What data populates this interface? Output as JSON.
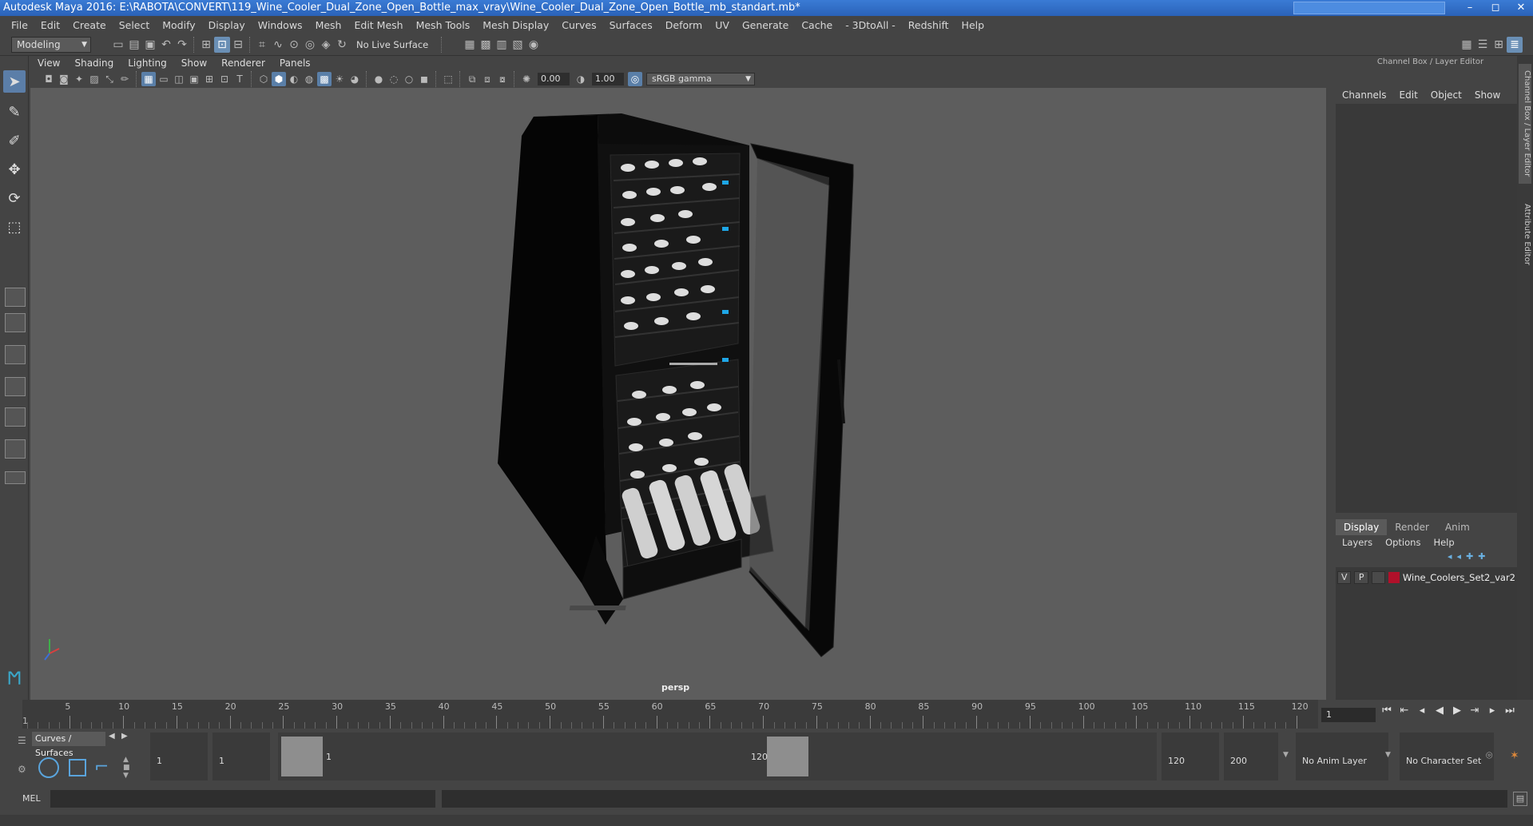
{
  "window": {
    "title": "Autodesk Maya 2016: E:\\RABOTA\\CONVERT\\119_Wine_Cooler_Dual_Zone_Open_Bottle_max_vray\\Wine_Cooler_Dual_Zone_Open_Bottle_mb_standart.mb*",
    "minimize": "–",
    "maximize": "◻",
    "close": "✕",
    "search_placeholder": ""
  },
  "menubar": [
    "File",
    "Edit",
    "Create",
    "Select",
    "Modify",
    "Display",
    "Windows",
    "Mesh",
    "Edit Mesh",
    "Mesh Tools",
    "Mesh Display",
    "Curves",
    "Surfaces",
    "Deform",
    "UV",
    "Generate",
    "Cache",
    "- 3DtoAll -",
    "Redshift",
    "Help"
  ],
  "shelf": {
    "mode": "Modeling",
    "live_surface": "No Live Surface"
  },
  "viewport": {
    "menu": [
      "View",
      "Shading",
      "Lighting",
      "Show",
      "Renderer",
      "Panels"
    ],
    "exposure": "0.00",
    "gamma": "1.00",
    "colorspace": "sRGB gamma",
    "camera_label": "persp"
  },
  "channel_box": {
    "header": "Channel Box / Layer Editor",
    "menu": [
      "Channels",
      "Edit",
      "Object",
      "Show"
    ],
    "side_tabs": [
      "Channel Box / Layer Editor",
      "Attribute Editor"
    ]
  },
  "layer_editor": {
    "tabs": [
      "Display",
      "Render",
      "Anim"
    ],
    "active_tab": "Display",
    "menu": [
      "Layers",
      "Options",
      "Help"
    ],
    "layers": [
      {
        "v": "V",
        "p": "P",
        "name": "Wine_Coolers_Set2_var2",
        "color": "#b0102a"
      }
    ]
  },
  "timeline": {
    "labels": [
      "5",
      "10",
      "15",
      "20",
      "25",
      "30",
      "35",
      "40",
      "45",
      "50",
      "55",
      "60",
      "65",
      "70",
      "75",
      "80",
      "85",
      "90",
      "95",
      "100",
      "105",
      "110",
      "115",
      "120"
    ],
    "start_marker": "1",
    "current_frame": "1"
  },
  "range": {
    "shelf_tab": "Curves / Surfaces",
    "start_a": "1",
    "start_b": "1",
    "handle_start": "1",
    "handle_end": "120",
    "end_a": "120",
    "end_b": "200",
    "anim_layer": "No Anim Layer",
    "character_set": "No Character Set"
  },
  "command": {
    "language": "MEL"
  }
}
